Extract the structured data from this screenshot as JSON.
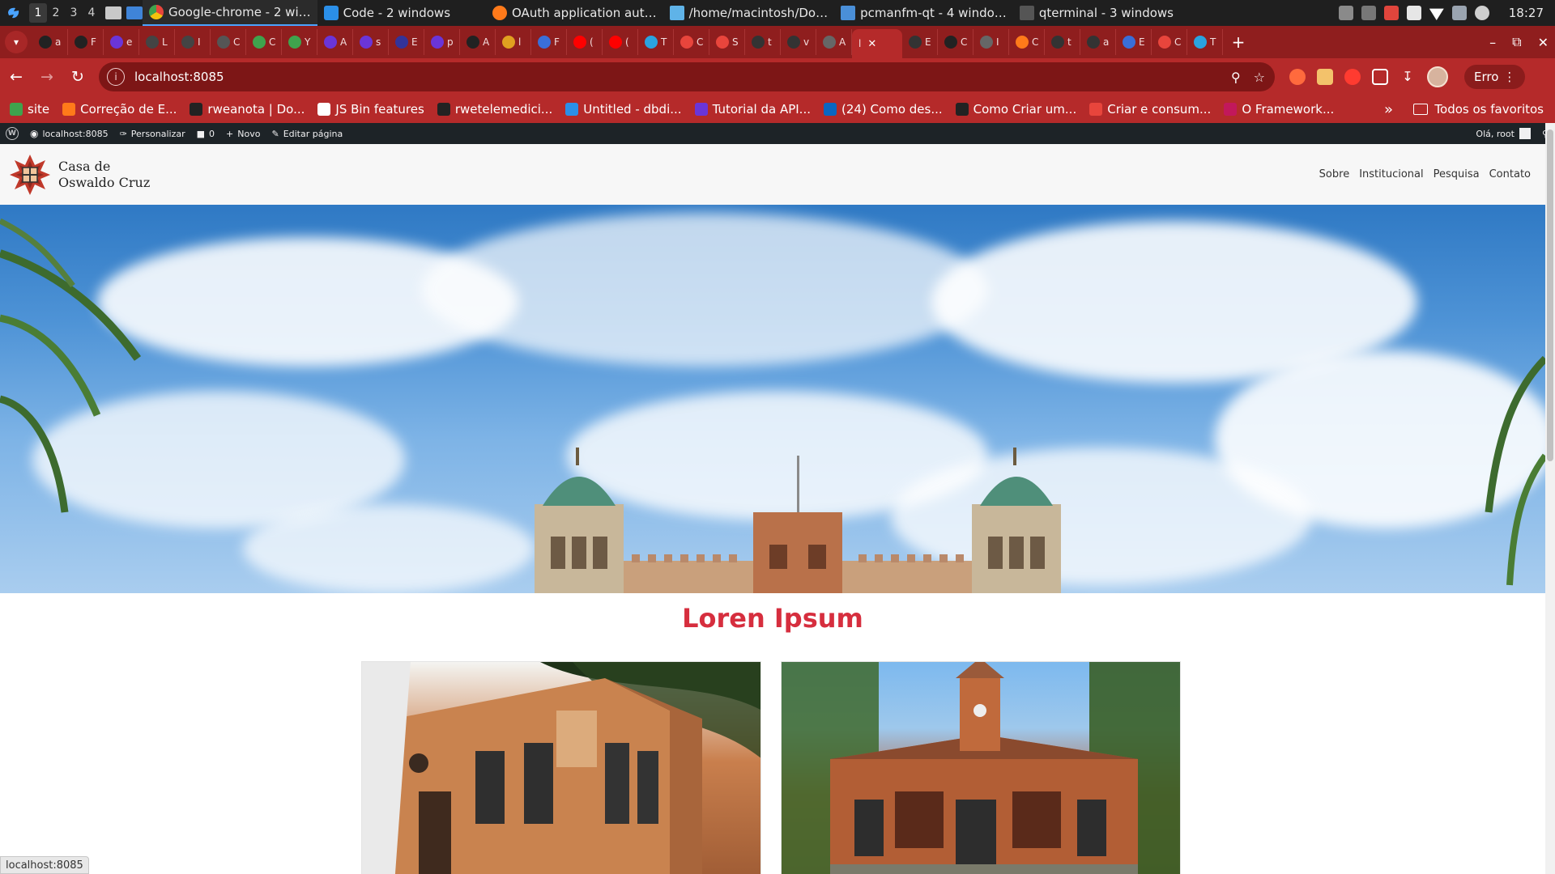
{
  "os": {
    "workspaces": [
      "1",
      "2",
      "3",
      "4"
    ],
    "tasks": [
      {
        "label": "Google-chrome - 2 wi…",
        "color": "#e8453c"
      },
      {
        "label": "Code - 2 windows",
        "color": "#2b8fe8"
      },
      {
        "label": "OAuth application aut…",
        "color": "#ff7a1a"
      },
      {
        "label": "/home/macintosh/Do…",
        "color": "#5fb3e8"
      },
      {
        "label": "pcmanfm-qt - 4 windo…",
        "color": "#4a8fd8"
      },
      {
        "label": "qterminal - 3 windows",
        "color": "#555555"
      }
    ],
    "clock": "18:27"
  },
  "browser": {
    "tabs": [
      {
        "label": "a",
        "color": "#222222"
      },
      {
        "label": "F",
        "color": "#222222"
      },
      {
        "label": "e",
        "color": "#6a35d8"
      },
      {
        "label": "L",
        "color": "#444444"
      },
      {
        "label": "I",
        "color": "#444444"
      },
      {
        "label": "C",
        "color": "#555555"
      },
      {
        "label": "C",
        "color": "#3fa34d"
      },
      {
        "label": "Y",
        "color": "#3fa34d"
      },
      {
        "label": "A",
        "color": "#6a35d8"
      },
      {
        "label": "s",
        "color": "#6a35d8"
      },
      {
        "label": "E",
        "color": "#333399"
      },
      {
        "label": "p",
        "color": "#6a35d8"
      },
      {
        "label": "A",
        "color": "#222222"
      },
      {
        "label": "l",
        "color": "#e0a020"
      },
      {
        "label": "F",
        "color": "#3a6ed8"
      },
      {
        "label": "(",
        "color": "#ff0000"
      },
      {
        "label": "(",
        "color": "#ff0000"
      },
      {
        "label": "T",
        "color": "#2aa3e0"
      },
      {
        "label": "C",
        "color": "#e8453c"
      },
      {
        "label": "S",
        "color": "#e8453c"
      },
      {
        "label": "t",
        "color": "#333333"
      },
      {
        "label": "v",
        "color": "#333333"
      },
      {
        "label": "A",
        "color": "#666666"
      }
    ],
    "active_tab": {
      "label": "l",
      "close": "✕"
    },
    "tabs_after": [
      {
        "label": "E",
        "color": "#333333"
      },
      {
        "label": "C",
        "color": "#222222"
      },
      {
        "label": "I",
        "color": "#666666"
      },
      {
        "label": "C",
        "color": "#ff7a1a"
      },
      {
        "label": "t",
        "color": "#333333"
      },
      {
        "label": "a",
        "color": "#333333"
      },
      {
        "label": "E",
        "color": "#3a6ed8"
      },
      {
        "label": "C",
        "color": "#e8453c"
      },
      {
        "label": "T",
        "color": "#2aa3e0"
      }
    ],
    "url": "localhost:8085",
    "erro_label": "Erro",
    "bookmarks": [
      {
        "label": "site",
        "color": "#3fa34d"
      },
      {
        "label": "Correção de E...",
        "color": "#ff7a1a"
      },
      {
        "label": "rweanota | Do...",
        "color": "#222222"
      },
      {
        "label": "JS Bin features",
        "color": "#ffffff"
      },
      {
        "label": "rwetelemedici...",
        "color": "#222222"
      },
      {
        "label": "Untitled - dbdi...",
        "color": "#2b8fe8"
      },
      {
        "label": "Tutorial da API...",
        "color": "#6a35d8"
      },
      {
        "label": "(24) Como des...",
        "color": "#0a66c2"
      },
      {
        "label": "Como Criar um...",
        "color": "#222222"
      },
      {
        "label": "Criar e consum...",
        "color": "#e8453c"
      },
      {
        "label": "O Framework...",
        "color": "#c2185b"
      }
    ],
    "bookmarks_more": "»",
    "all_bookmarks": "Todos os favoritos",
    "status_url": "localhost:8085"
  },
  "wp_admin": {
    "site": "localhost:8085",
    "customize": "Personalizar",
    "comments": "0",
    "new": "Novo",
    "edit": "Editar página",
    "greeting": "Olá, root"
  },
  "site": {
    "logo_line1": "Casa de",
    "logo_line2": "Oswaldo Cruz",
    "nav": [
      "Sobre",
      "Institucional",
      "Pesquisa",
      "Contato"
    ],
    "section_title": "Loren Ipsum",
    "accent": "#d62e3e"
  }
}
